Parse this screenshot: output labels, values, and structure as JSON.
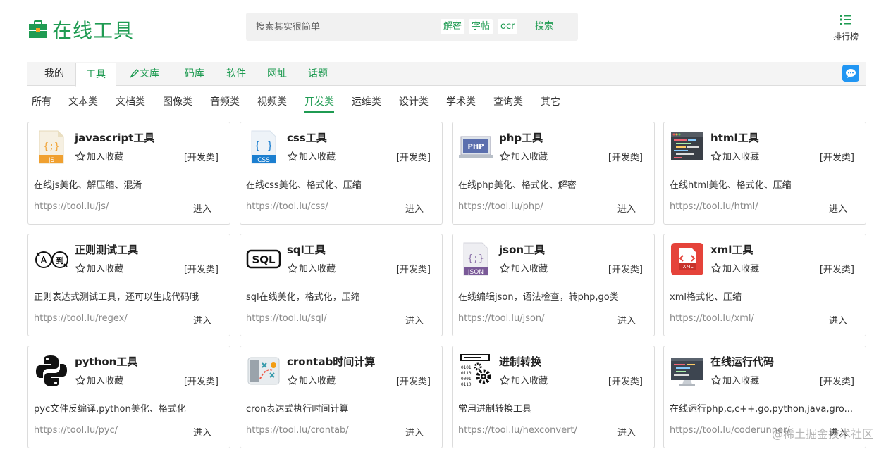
{
  "header": {
    "logo_text": "在线工具",
    "search_placeholder": "搜索其实很简单",
    "quick_links": [
      "解密",
      "字帖",
      "ocr"
    ],
    "search_label": "搜索",
    "rank_label": "排行榜"
  },
  "nav": {
    "items": [
      "我的",
      "工具",
      "文库",
      "码库",
      "软件",
      "网址",
      "话题"
    ]
  },
  "categories": [
    "所有",
    "文本类",
    "文档类",
    "图像类",
    "音频类",
    "视频类",
    "开发类",
    "运维类",
    "设计类",
    "学术类",
    "查询类",
    "其它"
  ],
  "card_common": {
    "fav_label": "加入收藏",
    "enter_label": "进入"
  },
  "cards": [
    {
      "title": "javascript工具",
      "tag": "[开发类]",
      "desc": "在线js美化、解压缩、混淆",
      "url": "https://tool.lu/js/",
      "icon": "js-file-icon"
    },
    {
      "title": "css工具",
      "tag": "[开发类]",
      "desc": "在线css美化、格式化、压缩",
      "url": "https://tool.lu/css/",
      "icon": "css-file-icon"
    },
    {
      "title": "php工具",
      "tag": "[开发类]",
      "desc": "在线php美化、格式化、解密",
      "url": "https://tool.lu/php/",
      "icon": "php-laptop-icon"
    },
    {
      "title": "html工具",
      "tag": "[开发类]",
      "desc": "在线html美化、格式化、压缩",
      "url": "https://tool.lu/html/",
      "icon": "html-code-icon"
    },
    {
      "title": "正则测试工具",
      "tag": "[开发类]",
      "desc": "正则表达式测试工具，还可以生成代码哦",
      "url": "https://tool.lu/regex/",
      "icon": "regex-icon"
    },
    {
      "title": "sql工具",
      "tag": "[开发类]",
      "desc": "sql在线美化，格式化，压缩",
      "url": "https://tool.lu/sql/",
      "icon": "sql-icon"
    },
    {
      "title": "json工具",
      "tag": "[开发类]",
      "desc": "在线编辑json，语法检查，转php,go类",
      "url": "https://tool.lu/json/",
      "icon": "json-file-icon"
    },
    {
      "title": "xml工具",
      "tag": "[开发类]",
      "desc": "xml格式化、压缩",
      "url": "https://tool.lu/xml/",
      "icon": "xml-file-icon"
    },
    {
      "title": "python工具",
      "tag": "[开发类]",
      "desc": "pyc文件反编译,python美化、格式化",
      "url": "https://tool.lu/pyc/",
      "icon": "python-icon"
    },
    {
      "title": "crontab时间计算",
      "tag": "[开发类]",
      "desc": "cron表达式执行时间计算",
      "url": "https://tool.lu/crontab/",
      "icon": "crontab-icon"
    },
    {
      "title": "进制转换",
      "tag": "[开发类]",
      "desc": "常用进制转换工具",
      "url": "https://tool.lu/hexconvert/",
      "icon": "binary-gear-icon"
    },
    {
      "title": "在线运行代码",
      "tag": "[开发类]",
      "desc": "在线运行php,c,c++,go,python,java,gro...",
      "url": "https://tool.lu/coderunner/",
      "icon": "monitor-code-icon"
    }
  ],
  "watermark": "@稀土掘金技术社区",
  "colors": {
    "brand": "#1f9b52",
    "chat": "#2196f3"
  }
}
